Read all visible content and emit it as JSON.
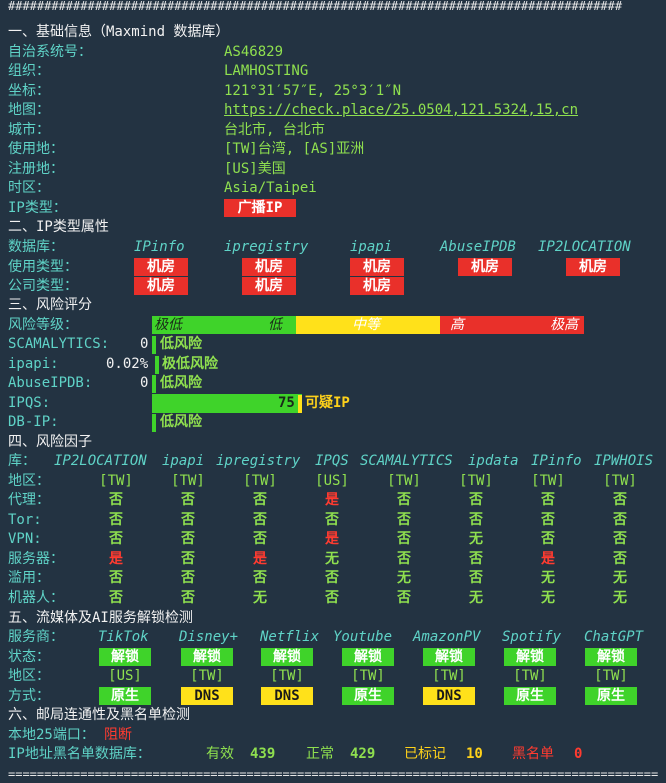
{
  "rule_top": "#####################################################################################",
  "rule_bottom": "===========================================================================================",
  "section1": {
    "title": "一、基础信息（Maxmind 数据库）",
    "rows": [
      {
        "key": "自治系统号：",
        "value": "AS46829"
      },
      {
        "key": "组织：",
        "value": "LAMHOSTING"
      },
      {
        "key": "坐标：",
        "value": "121°31′57″E, 25°3′1″N"
      },
      {
        "key": "地图：",
        "value": "https://check.place/25.0504,121.5324,15,cn"
      },
      {
        "key": "城市：",
        "value": "台北市, 台北市"
      },
      {
        "key": "使用地：",
        "value": "[TW]台湾, [AS]亚洲"
      },
      {
        "key": "注册地：",
        "value": "[US]美国"
      },
      {
        "key": "时区：",
        "value": "Asia/Taipei"
      }
    ],
    "ip_type_key": "IP类型：",
    "ip_type_value": "广播IP"
  },
  "section2": {
    "title": "二、IP类型属性",
    "db_key": "数据库：",
    "dbs": [
      "IPinfo",
      "ipregistry",
      "ipapi",
      "AbuseIPDB",
      "IP2LOCATION"
    ],
    "usage_key": "使用类型：",
    "usage": [
      "机房",
      "机房",
      "机房",
      "机房",
      "机房"
    ],
    "company_key": "公司类型：",
    "company": [
      "机房",
      "机房",
      "机房"
    ]
  },
  "section3": {
    "title": "三、风险评分",
    "level_key": "风险等级：",
    "levels": [
      "极低",
      "低",
      "中等",
      "高",
      "极高"
    ],
    "scamalytics_key": "SCAMALYTICS:",
    "scamalytics_score": "0",
    "scamalytics_label": "低风险",
    "ipapi_key": "ipapi:",
    "ipapi_score": "0.02%",
    "ipapi_label": "极低风险",
    "abuse_key": "AbuseIPDB:",
    "abuse_score": "0",
    "abuse_label": "低风险",
    "ipqs_key": "IPQS:",
    "ipqs_score": "75",
    "ipqs_label": "可疑IP",
    "ipqs_fraction": 0.75,
    "dbip_key": "DB-IP:",
    "dbip_label": "低风险"
  },
  "section4": {
    "title": "四、风险因子",
    "lib_key": "库：",
    "libs": [
      "IP2LOCATION",
      "ipapi",
      "ipregistry",
      "IPQS",
      "SCAMALYTICS",
      "ipdata",
      "IPinfo",
      "IPWHOIS"
    ],
    "rows": [
      {
        "key": "地区：",
        "cells": [
          "[TW]",
          "[TW]",
          "[TW]",
          "[US]",
          "[TW]",
          "[TW]",
          "[TW]",
          "[TW]"
        ],
        "colors": [
          "g",
          "g",
          "g",
          "g",
          "g",
          "g",
          "g",
          "g"
        ]
      },
      {
        "key": "代理：",
        "cells": [
          "否",
          "否",
          "否",
          "是",
          "否",
          "否",
          "否",
          "否"
        ],
        "colors": [
          "g",
          "g",
          "g",
          "r",
          "g",
          "g",
          "g",
          "g"
        ]
      },
      {
        "key": "Tor:",
        "cells": [
          "否",
          "否",
          "否",
          "否",
          "否",
          "否",
          "否",
          "否"
        ],
        "colors": [
          "g",
          "g",
          "g",
          "g",
          "g",
          "g",
          "g",
          "g"
        ]
      },
      {
        "key": "VPN:",
        "cells": [
          "否",
          "否",
          "否",
          "是",
          "否",
          "无",
          "否",
          "否"
        ],
        "colors": [
          "g",
          "g",
          "g",
          "r",
          "g",
          "g",
          "g",
          "g"
        ]
      },
      {
        "key": "服务器：",
        "cells": [
          "是",
          "否",
          "是",
          "无",
          "否",
          "否",
          "是",
          "否"
        ],
        "colors": [
          "r",
          "g",
          "r",
          "g",
          "g",
          "g",
          "r",
          "g"
        ]
      },
      {
        "key": "滥用：",
        "cells": [
          "否",
          "否",
          "否",
          "否",
          "无",
          "否",
          "无",
          "无"
        ],
        "colors": [
          "g",
          "g",
          "g",
          "g",
          "g",
          "g",
          "g",
          "g"
        ]
      },
      {
        "key": "机器人：",
        "cells": [
          "否",
          "否",
          "无",
          "否",
          "否",
          "无",
          "无",
          "无"
        ],
        "colors": [
          "g",
          "g",
          "g",
          "g",
          "g",
          "g",
          "g",
          "g"
        ]
      }
    ]
  },
  "section5": {
    "title": "五、流媒体及AI服务解锁检测",
    "svc_key": "服务商：",
    "services": [
      "TikTok",
      "Disney+",
      "Netflix",
      "Youtube",
      "AmazonPV",
      "Spotify",
      "ChatGPT"
    ],
    "status_key": "状态：",
    "status": [
      "解锁",
      "解锁",
      "解锁",
      "解锁",
      "解锁",
      "解锁",
      "解锁"
    ],
    "region_key": "地区：",
    "regions": [
      "[US]",
      "[TW]",
      "[TW]",
      "[TW]",
      "[TW]",
      "[TW]",
      "[TW]"
    ],
    "method_key": "方式：",
    "methods": [
      "原生",
      "DNS",
      "DNS",
      "原生",
      "DNS",
      "原生",
      "原生"
    ],
    "method_colors": [
      "g",
      "y",
      "y",
      "g",
      "y",
      "g",
      "g"
    ]
  },
  "section6": {
    "title": "六、邮局连通性及黑名单检测",
    "port_key": "本地25端口：",
    "port_value": "阻断",
    "bl_key": "IP地址黑名单数据库：",
    "valid_label": "有效",
    "valid_value": "439",
    "normal_label": "正常",
    "normal_value": "429",
    "marked_label": "已标记",
    "marked_value": "10",
    "black_label": "黑名单",
    "black_value": "0"
  },
  "colors": {
    "background": "#233342",
    "cyan": "#5fd3c7",
    "green": "#8fe04f",
    "red": "#e9302a",
    "bar_green": "#3fd32a",
    "yellow": "#ffe11a"
  }
}
